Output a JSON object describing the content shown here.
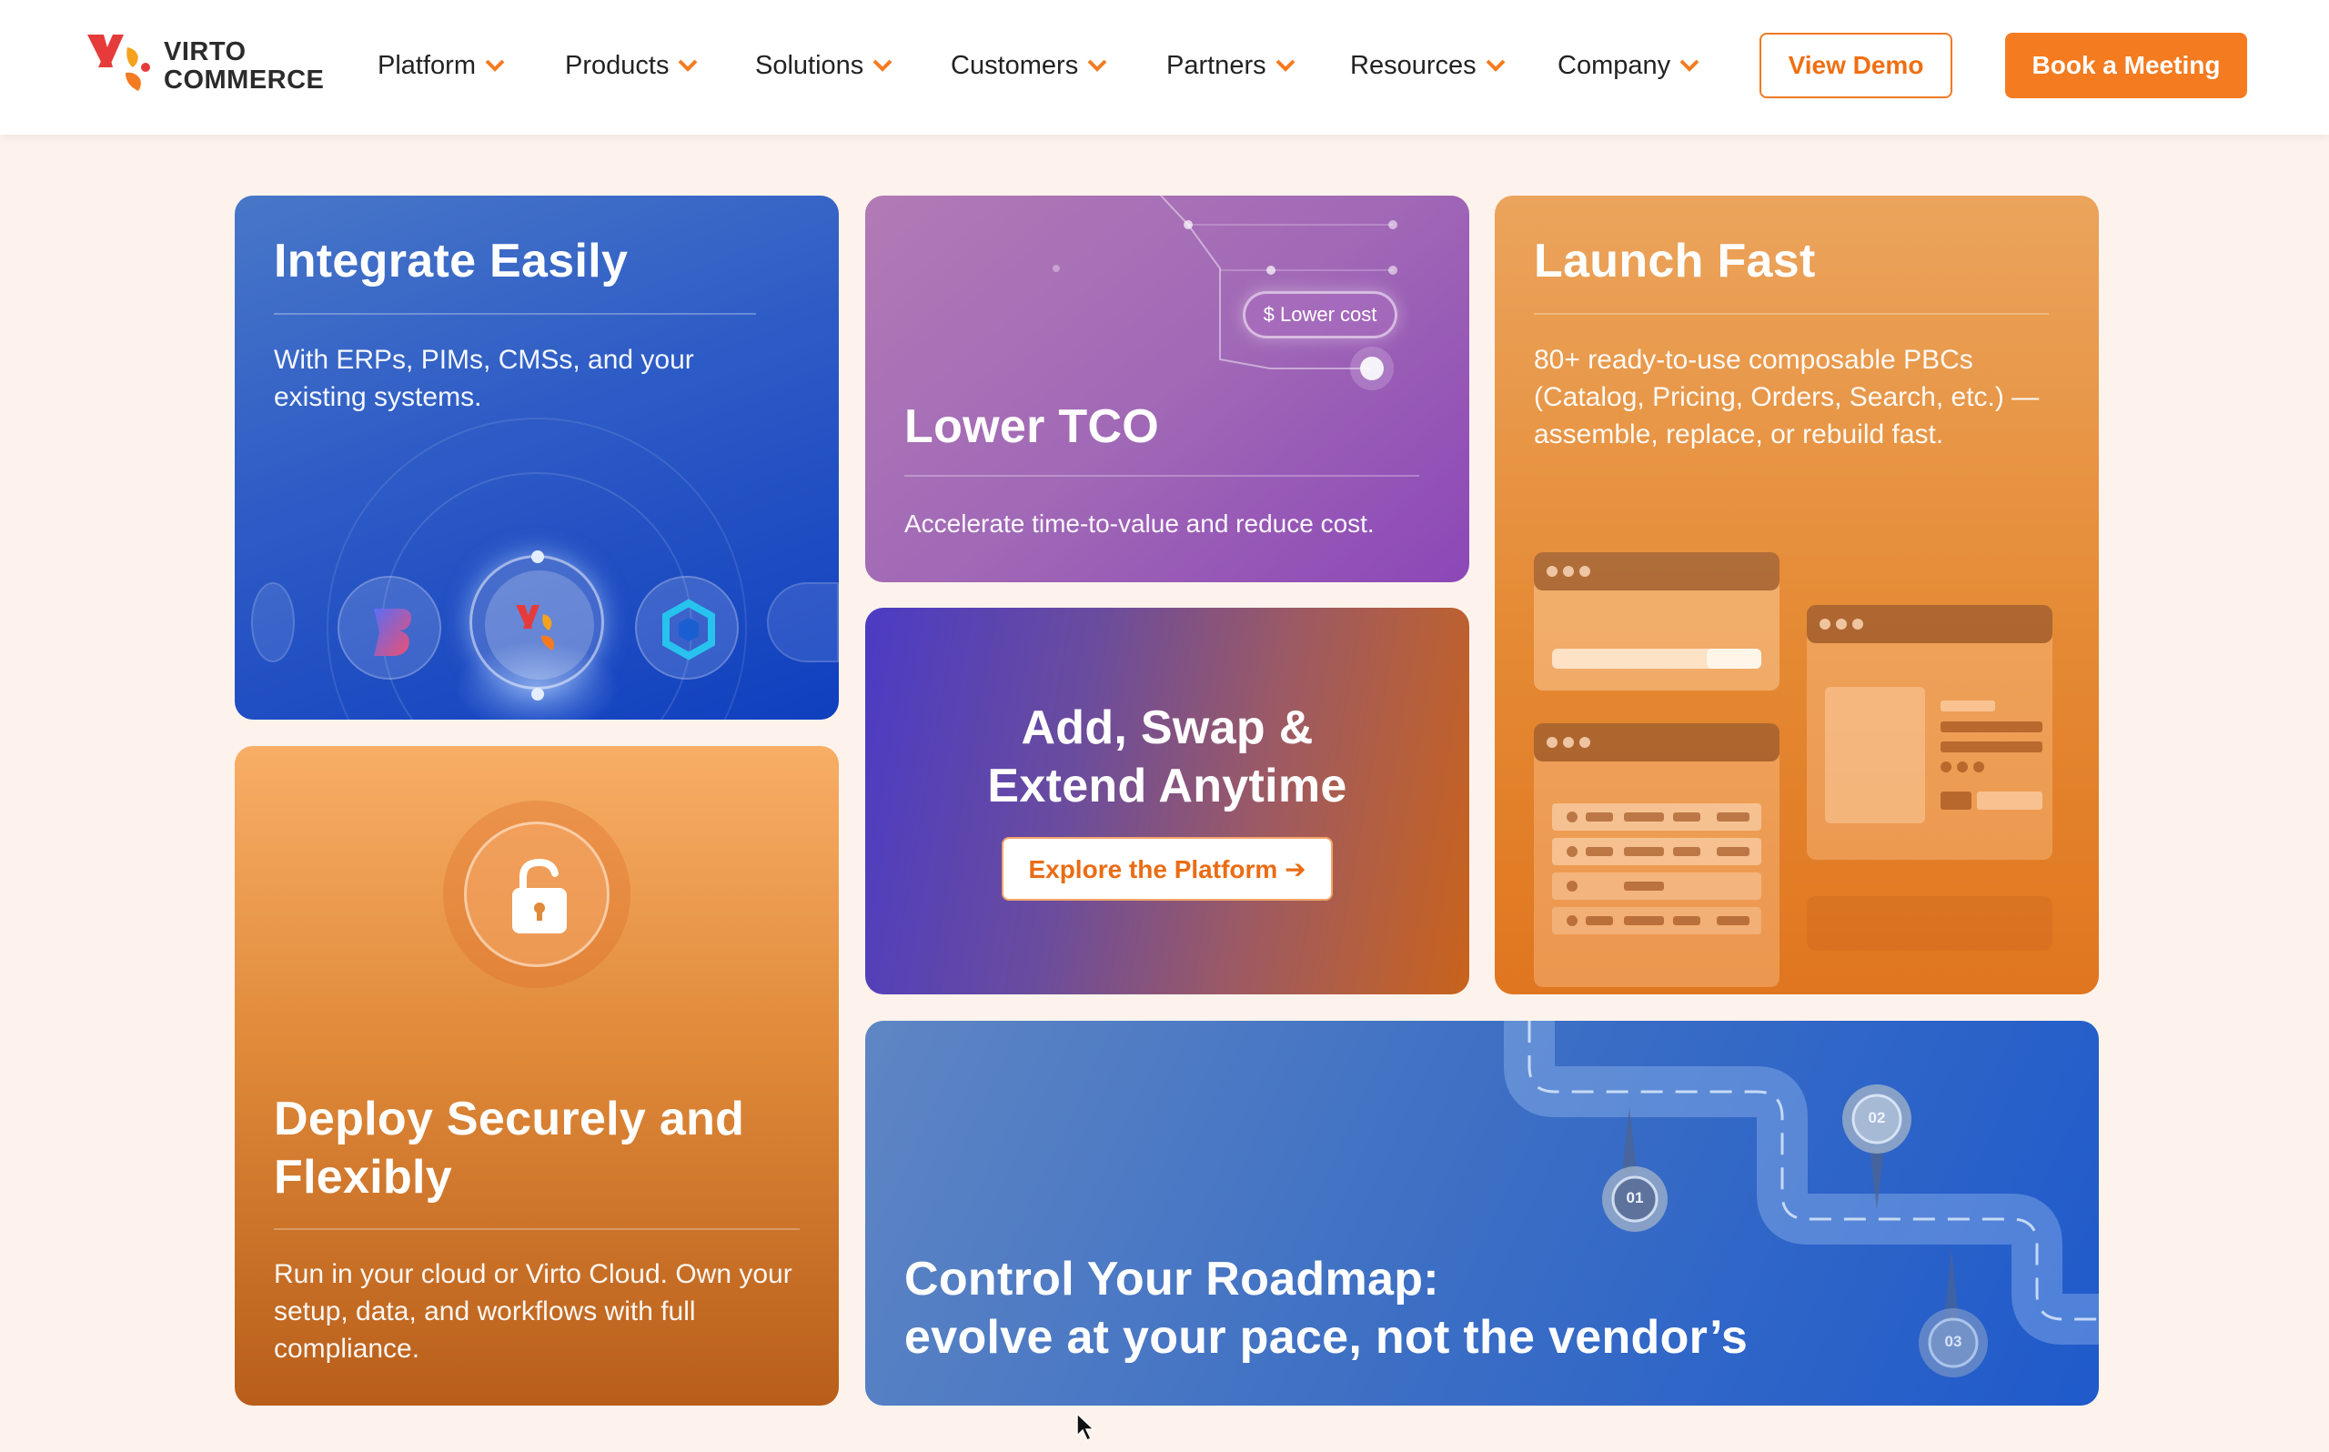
{
  "header": {
    "logo": {
      "line1": "VIRTO",
      "line2": "COMMERCE"
    },
    "nav": [
      {
        "label": "Platform"
      },
      {
        "label": "Products"
      },
      {
        "label": "Solutions"
      },
      {
        "label": "Customers"
      },
      {
        "label": "Partners"
      },
      {
        "label": "Resources"
      },
      {
        "label": "Company"
      }
    ],
    "view_demo": "View Demo",
    "book_meeting": "Book a Meeting"
  },
  "cards": {
    "integrate": {
      "title": "Integrate Easily",
      "body": "With ERPs, PIMs, CMSs, and your existing systems."
    },
    "tco": {
      "title": "Lower TCO",
      "body": "Accelerate time-to-value and reduce cost.",
      "pill": "$ Lower cost"
    },
    "launch": {
      "title": "Launch Fast",
      "body": "80+ ready-to-use composable PBCs (Catalog, Pricing, Orders, Search, etc.) — assemble, replace, or rebuild fast."
    },
    "addswap": {
      "title_line1": "Add, Swap &",
      "title_line2": "Extend Anytime",
      "button": "Explore the Platform ➔"
    },
    "deploy": {
      "title": "Deploy Securely and Flexibly",
      "body": "Run in your cloud or Virto Cloud. Own your setup, data, and workflows with full compliance."
    },
    "roadmap": {
      "title_line1": "Control Your Roadmap:",
      "title_line2": "evolve at your pace, not the vendor’s",
      "pins": [
        "01",
        "02",
        "03"
      ]
    }
  },
  "colors": {
    "accent": "#f47b20",
    "page_bg": "#fdf3ec"
  }
}
